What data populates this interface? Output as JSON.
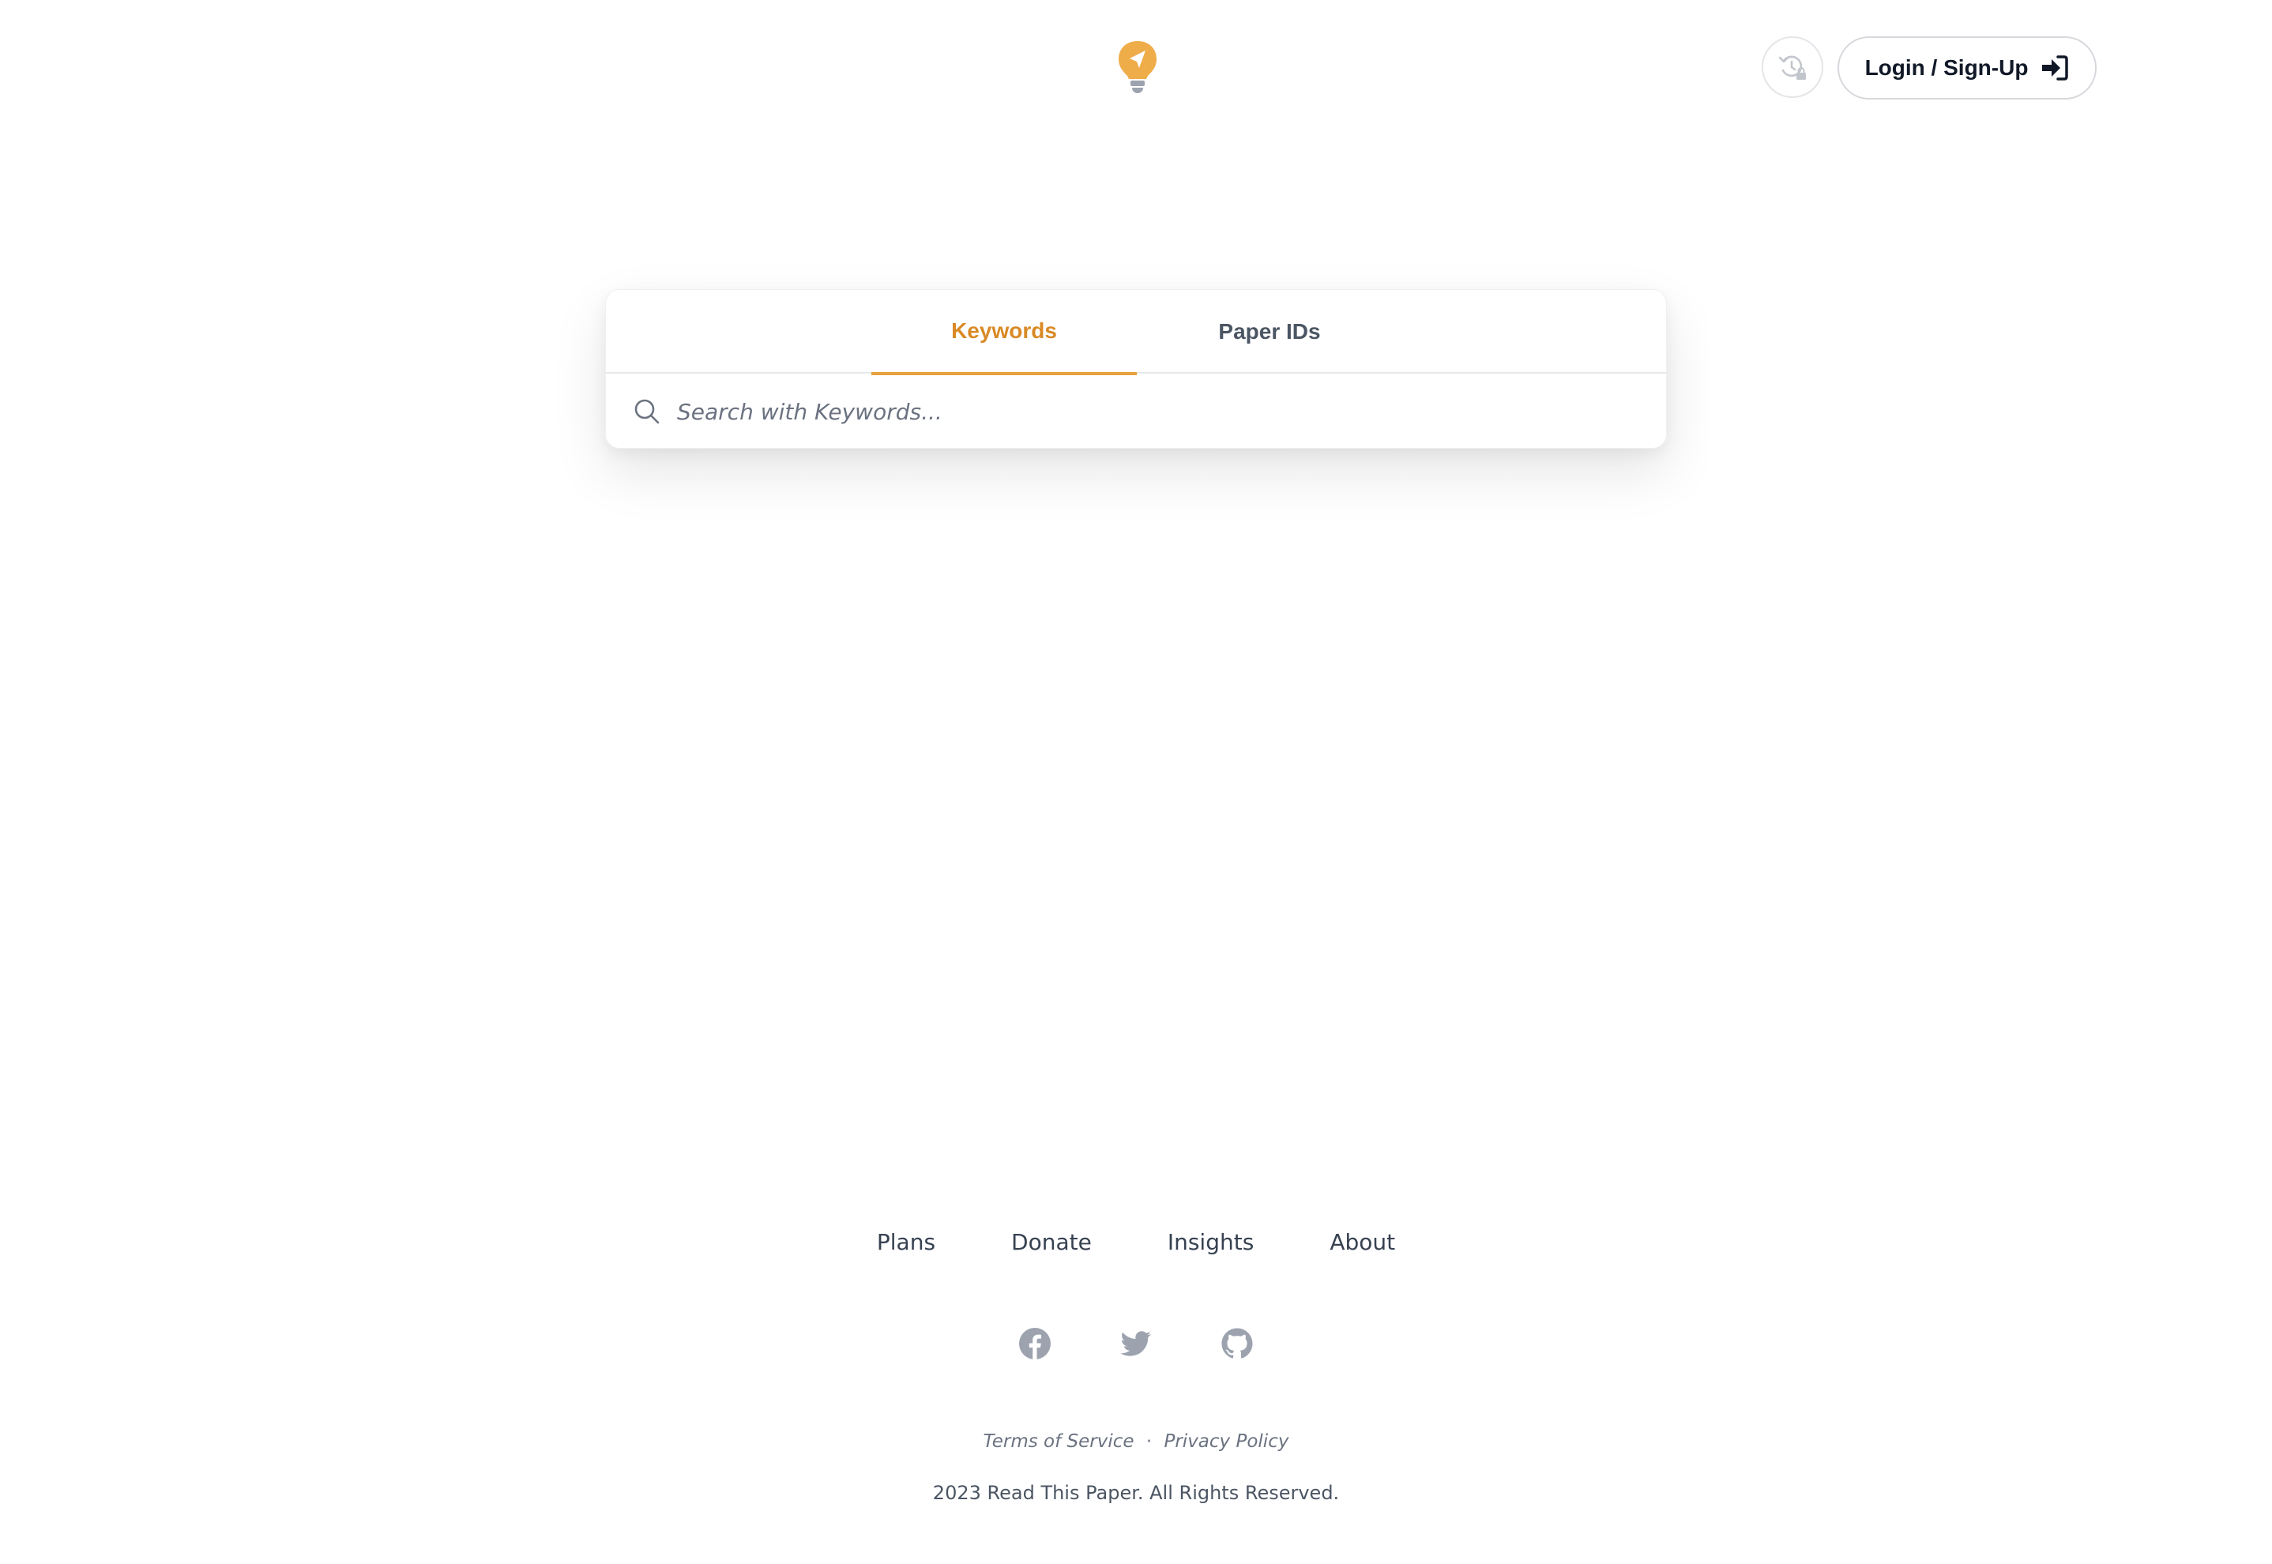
{
  "header": {
    "logo_icon": "lightbulb-paper-plane-logo",
    "history_icon": "locked-history-icon",
    "login_label": "Login / Sign-Up",
    "login_icon": "sign-in-icon"
  },
  "search": {
    "tabs": [
      {
        "label": "Keywords",
        "active": true
      },
      {
        "label": "Paper IDs",
        "active": false
      }
    ],
    "placeholder": "Search with Keywords...",
    "value": "",
    "icon": "search-icon"
  },
  "footer": {
    "nav": [
      "Plans",
      "Donate",
      "Insights",
      "About"
    ],
    "social": [
      "facebook-icon",
      "twitter-icon",
      "github-icon"
    ],
    "legal": {
      "terms": "Terms of Service",
      "separator": "·",
      "privacy": "Privacy Policy"
    },
    "copyright": "2023 Read This Paper. All Rights Reserved."
  },
  "colors": {
    "accent": "#e8a13c",
    "accent_text": "#d98a26",
    "text": "#374151",
    "muted": "#6b7280",
    "icon_gray": "#9ca3af"
  }
}
